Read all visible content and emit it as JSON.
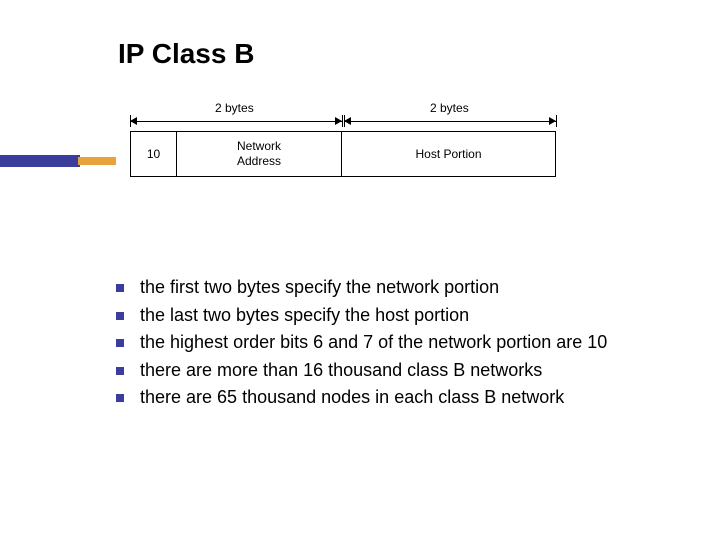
{
  "title": "IP Class B",
  "diagram": {
    "label_left": "2 bytes",
    "label_right": "2 bytes",
    "box_prefix": "10",
    "box_netaddr": "Network\nAddress",
    "box_host": "Host Portion"
  },
  "bullets": [
    "the first two bytes specify the network portion",
    "the last two bytes specify the host portion",
    "the highest order bits 6 and 7 of the network portion are 10",
    "there are more than 16 thousand class B networks",
    "there are 65 thousand nodes in each class B network"
  ]
}
